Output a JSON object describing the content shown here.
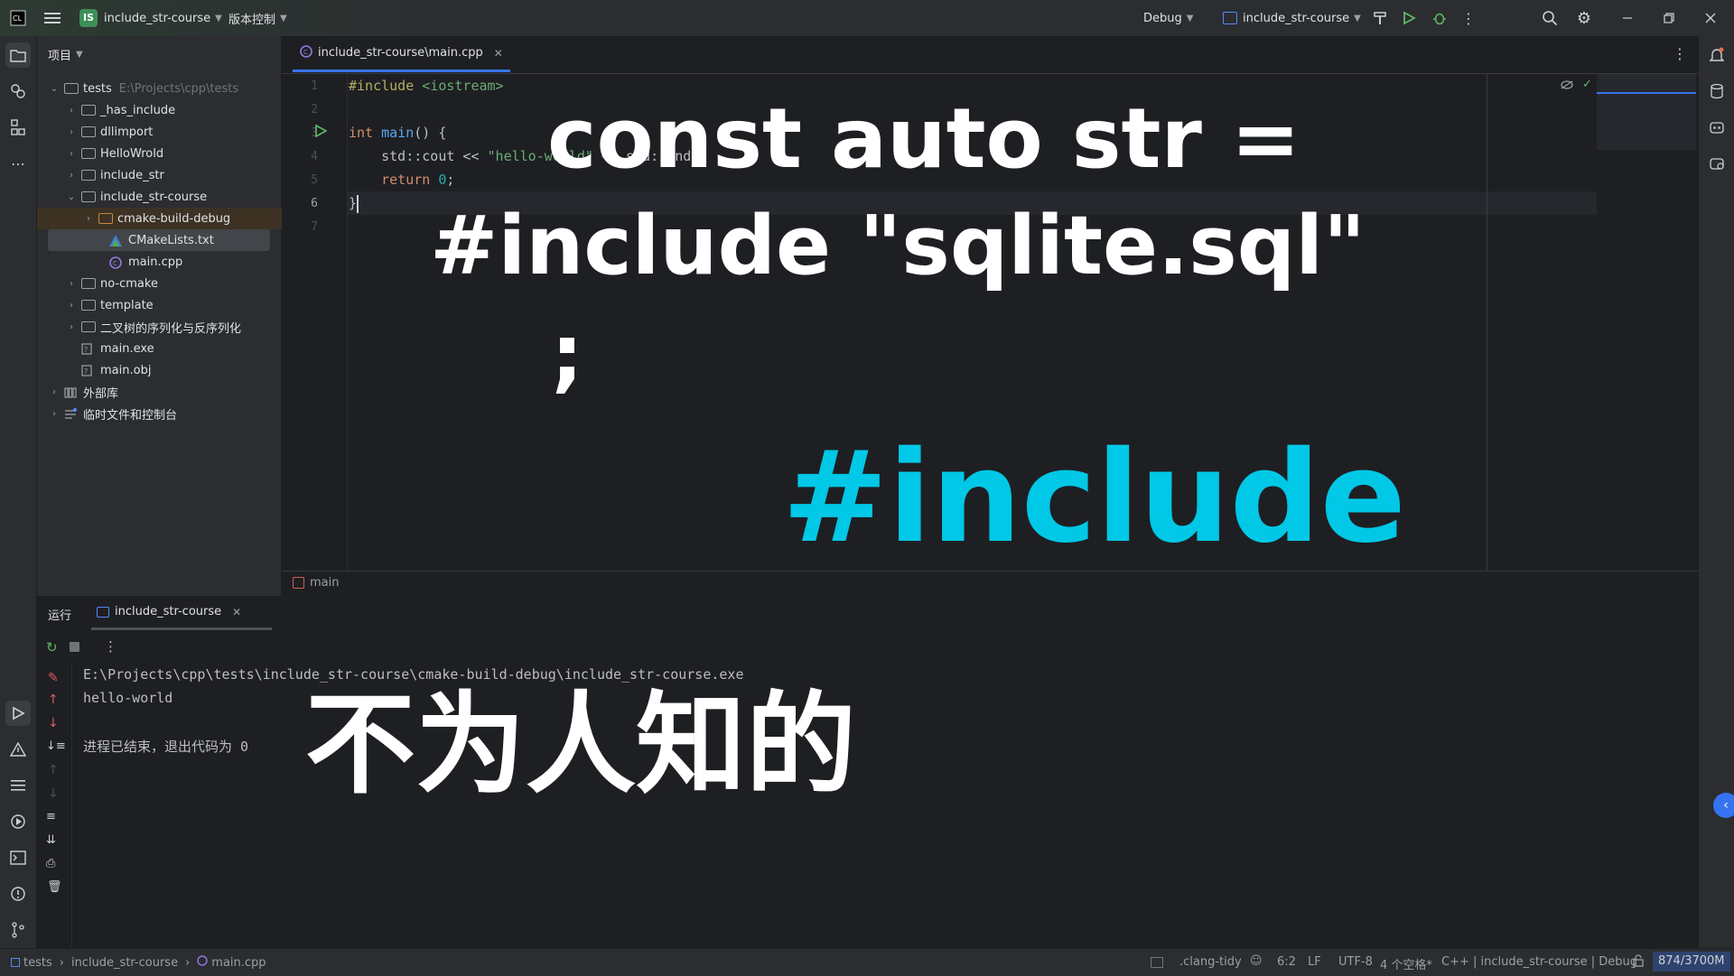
{
  "titlebar": {
    "project_badge": "IS",
    "project_name": "include_str-course",
    "vcs_label": "版本控制",
    "run_config": "Debug",
    "target": "include_str-course"
  },
  "project_panel": {
    "title": "项目",
    "root": {
      "name": "tests",
      "path": "E:\\Projects\\cpp\\tests"
    },
    "items": [
      {
        "label": "_has_include"
      },
      {
        "label": "dllimport"
      },
      {
        "label": "HelloWrold"
      },
      {
        "label": "include_str"
      },
      {
        "label": "include_str-course"
      },
      {
        "label": "cmake-build-debug"
      },
      {
        "label": "CMakeLists.txt"
      },
      {
        "label": "main.cpp"
      },
      {
        "label": "no-cmake"
      },
      {
        "label": "template"
      },
      {
        "label": "二叉树的序列化与反序列化"
      },
      {
        "label": "main.exe"
      },
      {
        "label": "main.obj"
      },
      {
        "label": "外部库"
      },
      {
        "label": "临时文件和控制台"
      }
    ]
  },
  "editor": {
    "tab_label": "include_str-course\\main.cpp",
    "line_numbers": [
      "1",
      "2",
      "3",
      "4",
      "5",
      "6",
      "7"
    ],
    "code": {
      "l1_directive": "#include",
      "l1_header": "<iostream>",
      "l3_type": "int",
      "l3_fn": "main",
      "l3_rest": "() {",
      "l4_a": "std::cout << ",
      "l4_str": "\"hello-world\"",
      "l4_rest": " << std::endl;",
      "l5_kw": "return",
      "l5_num": "0",
      "l5_rest": ";",
      "l6": "}"
    },
    "breadcrumb": "main"
  },
  "overlays": {
    "line1": "const auto str =",
    "line2": "#include \"sqlite.sql\"",
    "line3": ";",
    "big_include": "#include",
    "chinese": "不为人知的"
  },
  "run_panel": {
    "title": "运行",
    "tab": "include_str-course",
    "console": [
      "E:\\Projects\\cpp\\tests\\include_str-course\\cmake-build-debug\\include_str-course.exe",
      "hello-world",
      "",
      "进程已结束，退出代码为 0"
    ]
  },
  "statusbar": {
    "crumbs": [
      "tests",
      "include_str-course",
      "main.cpp"
    ],
    "lint": ".clang-tidy",
    "position": "6:2",
    "line_ending": "LF",
    "encoding": "UTF-8",
    "indent": "4 个空格*",
    "context": "C++ | include_str-course | Debug",
    "memory": "874/3700M"
  }
}
